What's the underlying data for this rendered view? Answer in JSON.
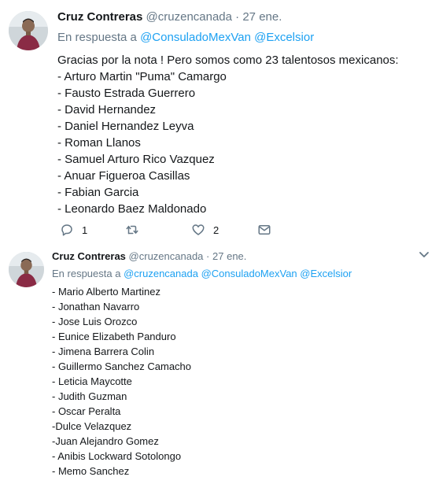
{
  "tweets": [
    {
      "author_name": "Cruz Contreras",
      "handle": "@cruzencanada",
      "separator": "·",
      "date": "27 ene.",
      "reply_prefix": "En respuesta a",
      "mentions": [
        "@ConsuladoMexVan",
        "@Excelsior"
      ],
      "intro": "Gracias por la nota ! Pero somos como 23 talentosos mexicanos:",
      "lines": [
        "- Arturo Martin \"Puma\" Camargo",
        "- Fausto Estrada Guerrero",
        "- David Hernandez",
        "- Daniel Hernandez Leyva",
        "- Roman Llanos",
        "- Samuel Arturo Rico Vazquez",
        "- Anuar Figueroa Casillas",
        "- Fabian Garcia",
        "- Leonardo Baez Maldonado"
      ],
      "actions": {
        "reply_count": "1",
        "like_count": "2"
      }
    },
    {
      "author_name": "Cruz Contreras",
      "handle": "@cruzencanada",
      "separator": "·",
      "date": "27 ene.",
      "reply_prefix": "En respuesta a",
      "mentions": [
        "@cruzencanada",
        "@ConsuladoMexVan",
        "@Excelsior"
      ],
      "lines": [
        "- Mario Alberto Martinez",
        "- Jonathan Navarro",
        "- Jose Luis Orozco",
        "- Eunice Elizabeth Panduro",
        "- Jimena Barrera Colin",
        "- Guillermo Sanchez Camacho",
        "- Leticia Maycotte",
        "- Judith Guzman",
        "- Oscar Peralta",
        "-Dulce Velazquez",
        "-Juan Alejandro Gomez",
        "- Anibis Lockward Sotolongo",
        "- Memo Sanchez"
      ]
    }
  ],
  "icons": {
    "reply": "reply-icon",
    "retweet": "retweet-icon",
    "like": "heart-icon",
    "dm": "envelope-icon",
    "more": "chevron-down-icon"
  },
  "colors": {
    "link": "#1da1f2",
    "secondary_text": "#657786",
    "primary_text": "#14171a"
  }
}
